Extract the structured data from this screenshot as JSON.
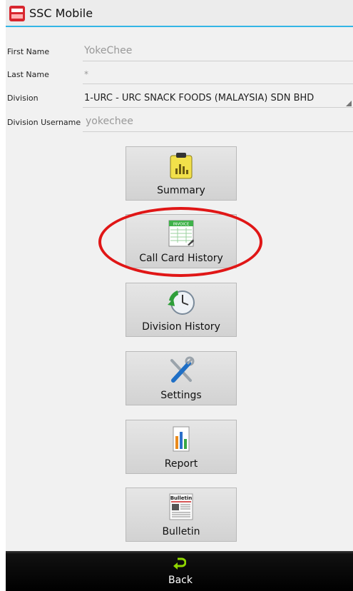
{
  "app": {
    "title": "SSC Mobile"
  },
  "form": {
    "first_name": {
      "label": "First Name",
      "value": "YokeChee"
    },
    "last_name": {
      "label": "Last Name",
      "value": "*"
    },
    "division": {
      "label": "Division",
      "value": "1-URC - URC SNACK FOODS (MALAYSIA) SDN BHD"
    },
    "division_username": {
      "label": "Division Username",
      "value": "yokechee"
    }
  },
  "menu": {
    "summary": {
      "label": "Summary",
      "icon": "clipboard-chart-icon"
    },
    "call_card_history": {
      "label": "Call Card History",
      "icon": "invoice-icon",
      "icon_text": "INVOICE"
    },
    "division_history": {
      "label": "Division History",
      "icon": "clock-history-icon"
    },
    "settings": {
      "label": "Settings",
      "icon": "wrench-screwdriver-icon"
    },
    "report": {
      "label": "Report",
      "icon": "report-chart-icon"
    },
    "bulletin": {
      "label": "Bulletin",
      "icon": "newspaper-icon",
      "icon_text": "Bulletin"
    }
  },
  "footer": {
    "back_label": "Back",
    "icon": "back-arrow-icon"
  },
  "colors": {
    "accent": "#33b5e5",
    "highlight": "#e01616",
    "back_icon": "#8fd600"
  }
}
